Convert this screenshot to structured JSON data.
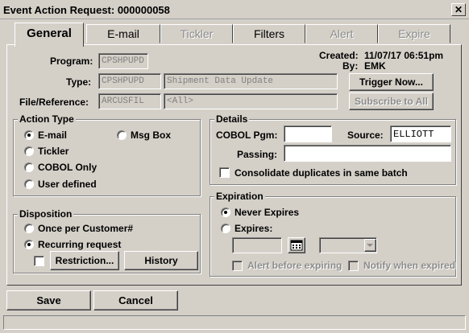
{
  "window": {
    "title": "Event Action Request: 000000058",
    "close_symbol": "✕"
  },
  "tabs": [
    {
      "label": "General",
      "active": true
    },
    {
      "label": "E-mail"
    },
    {
      "label": "Tickler",
      "disabled": true
    },
    {
      "label": "Filters"
    },
    {
      "label": "Alert",
      "disabled": true
    },
    {
      "label": "Expire",
      "disabled": true
    }
  ],
  "header": {
    "program_label": "Program:",
    "program_value": "CPSHPUPD",
    "type_label": "Type:",
    "type_value": "CPSHPUPD",
    "type_desc": "Shipment Data Update",
    "file_label": "File/Reference:",
    "file_value": "ARCUSFIL",
    "file_ref": "<All>",
    "created_label": "Created:",
    "created_value": "11/07/17 06:51pm",
    "by_label": "By:",
    "by_value": "EMK",
    "trigger_now": "Trigger Now...",
    "subscribe_all": "Subscribe to All"
  },
  "action_type": {
    "title": "Action Type",
    "options": [
      "E-mail",
      "Tickler",
      "COBOL Only",
      "User defined",
      "Msg Box"
    ],
    "selected": "E-mail"
  },
  "disposition": {
    "title": "Disposition",
    "options": [
      "Once per Customer#",
      "Recurring request"
    ],
    "selected": "Recurring request",
    "restriction": "Restriction...",
    "history": "History"
  },
  "details": {
    "title": "Details",
    "cobol_pgm_label": "COBOL Pgm:",
    "cobol_pgm_value": "",
    "source_label": "Source:",
    "source_value": "ELLIOTT",
    "passing_label": "Passing:",
    "passing_value": "",
    "consolidate_label": "Consolidate duplicates in same batch"
  },
  "expiration": {
    "title": "Expiration",
    "never": "Never Expires",
    "expires": "Expires:",
    "selected": "Never Expires",
    "alert_before": "Alert before expiring",
    "notify_when": "Notify when expired"
  },
  "footer": {
    "save": "Save",
    "cancel": "Cancel"
  }
}
